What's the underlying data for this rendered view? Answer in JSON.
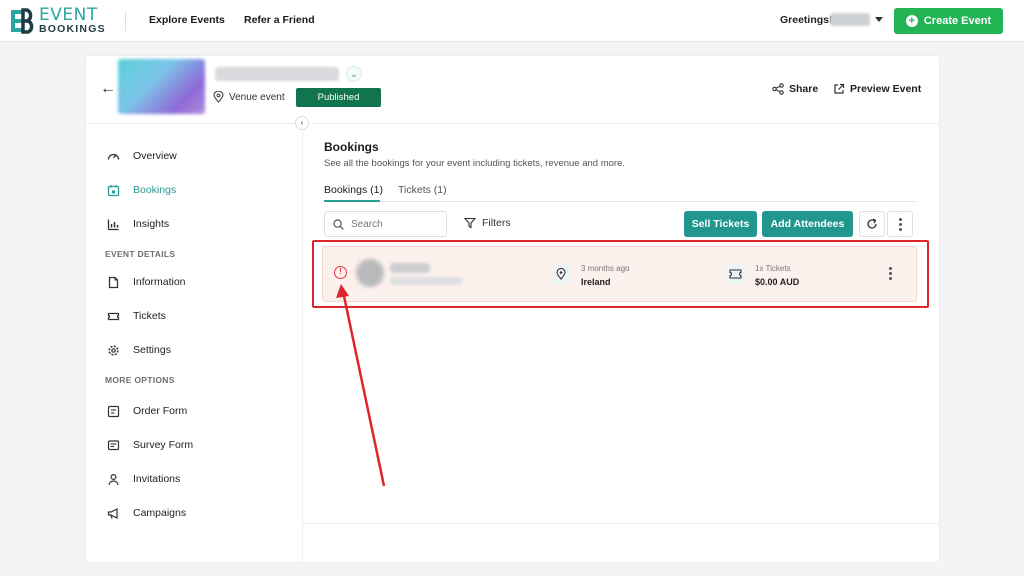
{
  "brand": {
    "line1": "EVENT",
    "line2": "BOOKINGS",
    "color": "#2aa7a1"
  },
  "nav": {
    "explore": "Explore Events",
    "refer": "Refer a Friend",
    "greeting": "Greetings!",
    "create": "Create Event"
  },
  "event": {
    "venue_label": "Venue event",
    "status": "Published",
    "share": "Share",
    "preview": "Preview Event"
  },
  "sidebar": {
    "items": [
      {
        "label": "Overview"
      },
      {
        "label": "Bookings"
      },
      {
        "label": "Insights"
      },
      {
        "label": "Information"
      },
      {
        "label": "Tickets"
      },
      {
        "label": "Settings"
      },
      {
        "label": "Order Form"
      },
      {
        "label": "Survey Form"
      },
      {
        "label": "Invitations"
      },
      {
        "label": "Campaigns"
      }
    ],
    "section_details": "EVENT DETAILS",
    "section_more": "MORE OPTIONS",
    "active": "Bookings"
  },
  "main": {
    "title": "Bookings",
    "subtitle": "See all the bookings for your event including tickets, revenue and more.",
    "tabs": [
      {
        "label": "Bookings (1)"
      },
      {
        "label": "Tickets (1)"
      }
    ],
    "search_placeholder": "Search",
    "filters": "Filters",
    "sell_tickets": "Sell Tickets",
    "add_attendees": "Add Attendees"
  },
  "booking": {
    "time_ago": "3 months ago",
    "location": "Ireland",
    "tickets": "1x Tickets",
    "amount": "$0.00 AUD"
  },
  "colors": {
    "accent": "#21968f",
    "create": "#22b455",
    "published": "#11744f",
    "alert": "#e0252a"
  }
}
